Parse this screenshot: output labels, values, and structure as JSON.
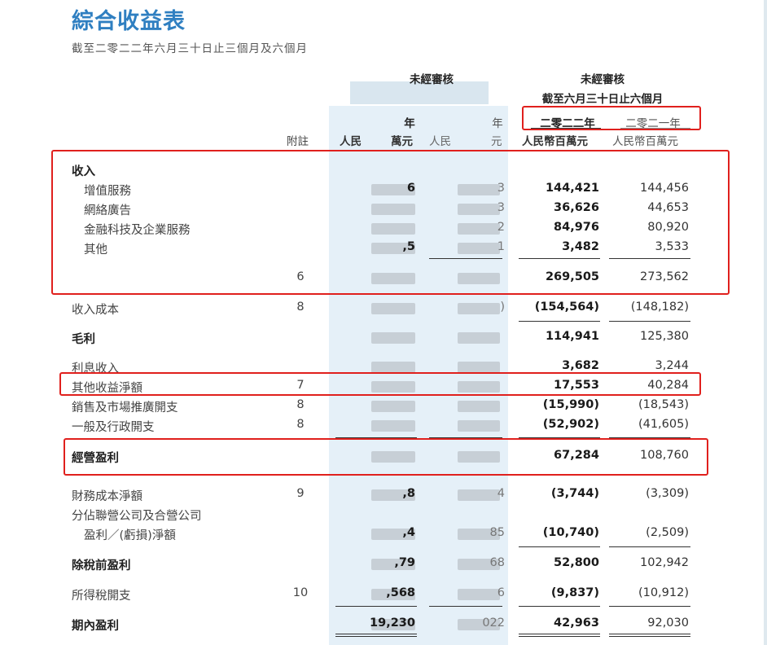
{
  "title": "綜合收益表",
  "subtitle": "截至二零二二年六月三十日止三個月及六個月",
  "header": {
    "unaudited_left": "未經審核",
    "unaudited_right": "未經審核",
    "six_months": "截至六月三十日止六個月",
    "year_partial_1": "年",
    "year_partial_2": "年",
    "year_2022": "二零二二年",
    "year_2021": "二零二一年",
    "note_col": "附註",
    "unit_partial_1": "人民",
    "unit_partial_1b": "萬元",
    "unit_partial_2": "人民",
    "unit_partial_2b": "元",
    "unit_2022": "人民幣百萬元",
    "unit_2021": "人民幣百萬元"
  },
  "rows": [
    {
      "label": "收入",
      "bold": true,
      "note": "",
      "v2022": "",
      "v2021": "",
      "visible_q": ""
    },
    {
      "label": "增值服務",
      "note": "",
      "v2022": "144,421",
      "v2021": "144,456",
      "visible_q": "3"
    },
    {
      "label": "網絡廣告",
      "note": "",
      "v2022": "36,626",
      "v2021": "44,653",
      "visible_q": "3"
    },
    {
      "label": "金融科技及企業服務",
      "note": "",
      "v2022": "84,976",
      "v2021": "80,920",
      "visible_q": "2"
    },
    {
      "label": "其他",
      "note": "",
      "v2022": "3,482",
      "v2021": "3,533",
      "visible_q": "1"
    },
    {
      "label": "",
      "note": "6",
      "v2022": "269,505",
      "v2021": "273,562",
      "visible_q": ""
    },
    {
      "label": "收入成本",
      "note": "8",
      "v2022": "(154,564)",
      "v2021": "(148,182)",
      "visible_q": ")"
    },
    {
      "label": "毛利",
      "bold": true,
      "note": "",
      "v2022": "114,941",
      "v2021": "125,380",
      "visible_q": ""
    },
    {
      "label": "利息收入",
      "note": "",
      "v2022": "3,682",
      "v2021": "3,244",
      "visible_q": ""
    },
    {
      "label": "其他收益淨額",
      "note": "7",
      "v2022": "17,553",
      "v2021": "40,284",
      "visible_q": ""
    },
    {
      "label": "銷售及市場推廣開支",
      "note": "8",
      "v2022": "(15,990)",
      "v2021": "(18,543)",
      "visible_q": ""
    },
    {
      "label": "一般及行政開支",
      "note": "8",
      "v2022": "(52,902)",
      "v2021": "(41,605)",
      "visible_q": ""
    },
    {
      "label": "經營盈利",
      "bold": true,
      "note": "",
      "v2022": "67,284",
      "v2021": "108,760",
      "visible_q": ""
    },
    {
      "label": "財務成本淨額",
      "note": "9",
      "v2022": "(3,744)",
      "v2021": "(3,309)",
      "visible_q": "4"
    },
    {
      "label": "分佔聯營公司及合營公司",
      "note": "",
      "v2022": "",
      "v2021": "",
      "visible_q": ""
    },
    {
      "label": "盈利／(虧損)淨額",
      "note": "",
      "v2022": "(10,740)",
      "v2021": "(2,509)",
      "visible_q": "85"
    },
    {
      "label": "除稅前盈利",
      "bold": true,
      "note": "",
      "v2022": "52,800",
      "v2021": "102,942",
      "visible_q": "68"
    },
    {
      "label": "所得稅開支",
      "note": "10",
      "v2022": "(9,837)",
      "v2021": "(10,912)",
      "visible_q": "6"
    },
    {
      "label": "期內盈利",
      "bold": true,
      "note": "",
      "v2022": "42,963",
      "v2021": "92,030",
      "visible_q": "022"
    }
  ],
  "visible_q1": {
    "r1": "6",
    "r4": ",5",
    "r13": ",8",
    "r15": ",4",
    "r16": ",79",
    "r17": ",568",
    "r18": "19,230"
  }
}
